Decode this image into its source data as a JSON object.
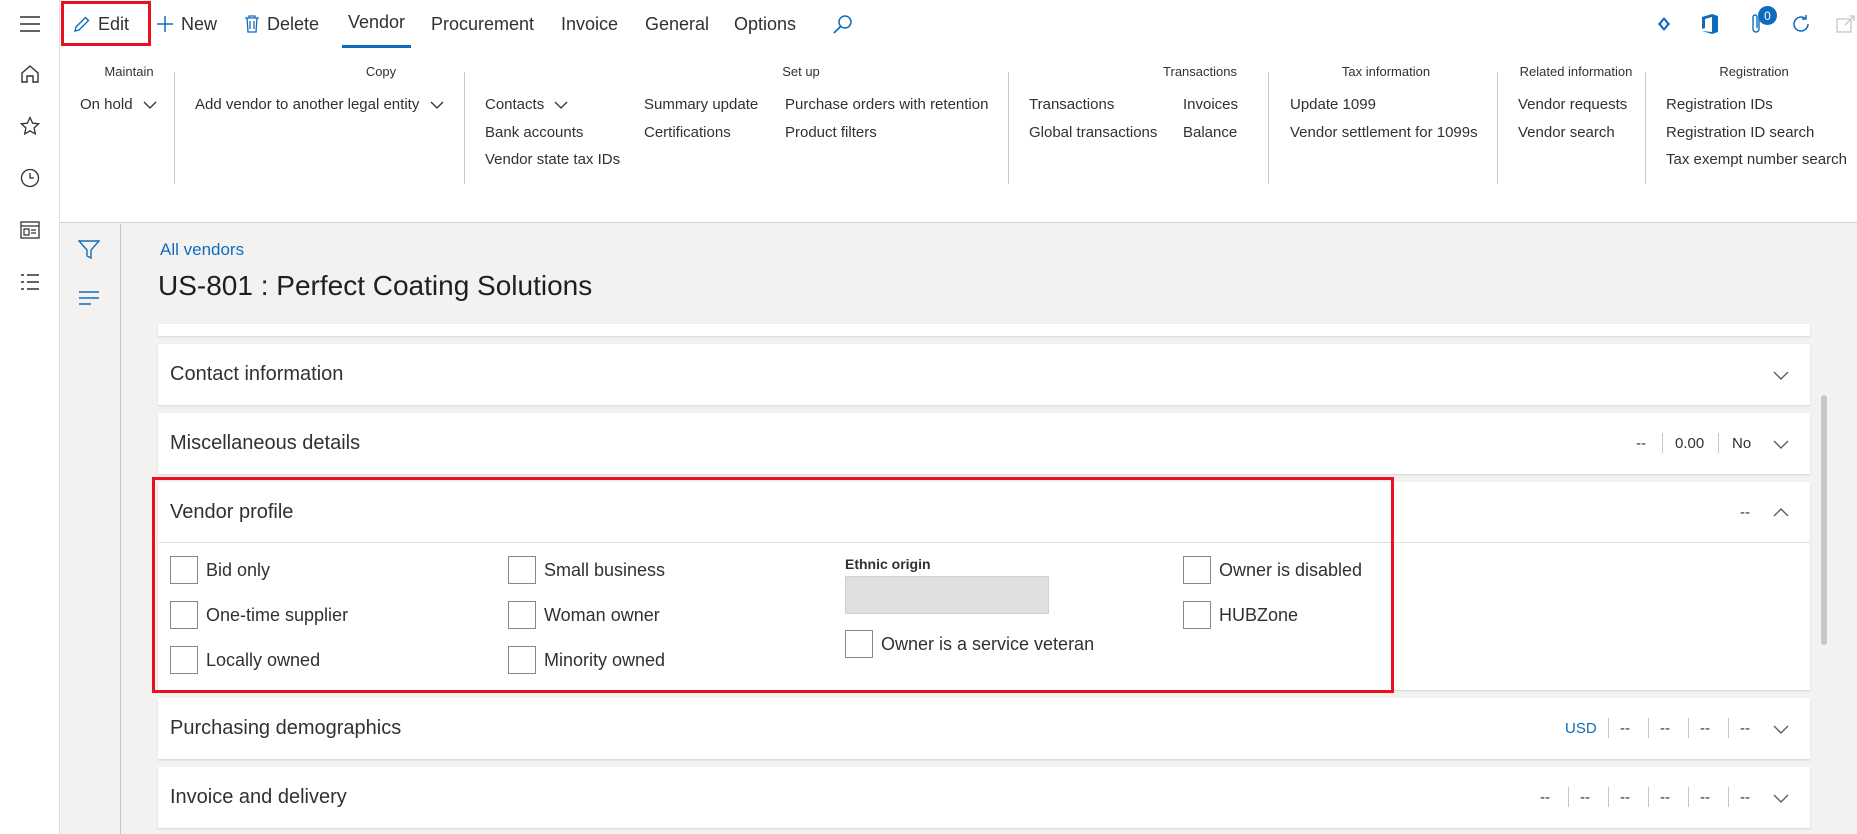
{
  "actions": {
    "edit": "Edit",
    "new": "New",
    "delete": "Delete"
  },
  "tabs": [
    "Vendor",
    "Procurement",
    "Invoice",
    "General",
    "Options"
  ],
  "notification_count": "0",
  "ribbon": {
    "maintain": {
      "title": "Maintain",
      "items": [
        "On hold"
      ]
    },
    "copy": {
      "title": "Copy",
      "items": [
        "Add vendor to another legal entity"
      ]
    },
    "setup": {
      "title": "Set up",
      "items": [
        "Contacts",
        "Bank accounts",
        "Vendor state tax IDs",
        "Summary update",
        "Certifications",
        "Purchase orders with retention",
        "Product filters"
      ]
    },
    "transactions": {
      "title": "Transactions",
      "items": [
        "Transactions",
        "Global transactions",
        "Invoices",
        "Balance"
      ]
    },
    "tax": {
      "title": "Tax information",
      "items": [
        "Update 1099",
        "Vendor settlement for 1099s"
      ]
    },
    "related": {
      "title": "Related information",
      "items": [
        "Vendor requests",
        "Vendor search"
      ]
    },
    "registration": {
      "title": "Registration",
      "items": [
        "Registration IDs",
        "Registration ID search",
        "Tax exempt number search"
      ]
    }
  },
  "breadcrumb": "All vendors",
  "page_title": "US-801 : Perfect Coating Solutions",
  "sections": {
    "contact": {
      "title": "Contact information"
    },
    "misc": {
      "title": "Miscellaneous details",
      "summary": [
        "--",
        "0.00",
        "No"
      ]
    },
    "profile": {
      "title": "Vendor profile",
      "summary": [
        "--"
      ],
      "checkboxes": {
        "bid_only": "Bid only",
        "one_time": "One-time supplier",
        "locally_owned": "Locally owned",
        "small_business": "Small business",
        "woman_owner": "Woman owner",
        "minority_owned": "Minority owned",
        "service_veteran": "Owner is a service veteran",
        "disabled": "Owner is disabled",
        "hubzone": "HUBZone"
      },
      "ethnic_origin_label": "Ethnic origin"
    },
    "purchasing": {
      "title": "Purchasing demographics",
      "summary": [
        "USD",
        "--",
        "--",
        "--",
        "--"
      ]
    },
    "invoice": {
      "title": "Invoice and delivery",
      "summary": [
        "--",
        "--",
        "--",
        "--",
        "--",
        "--"
      ]
    }
  },
  "colors": {
    "accent": "#0f6cbd",
    "highlight": "#e81123"
  }
}
